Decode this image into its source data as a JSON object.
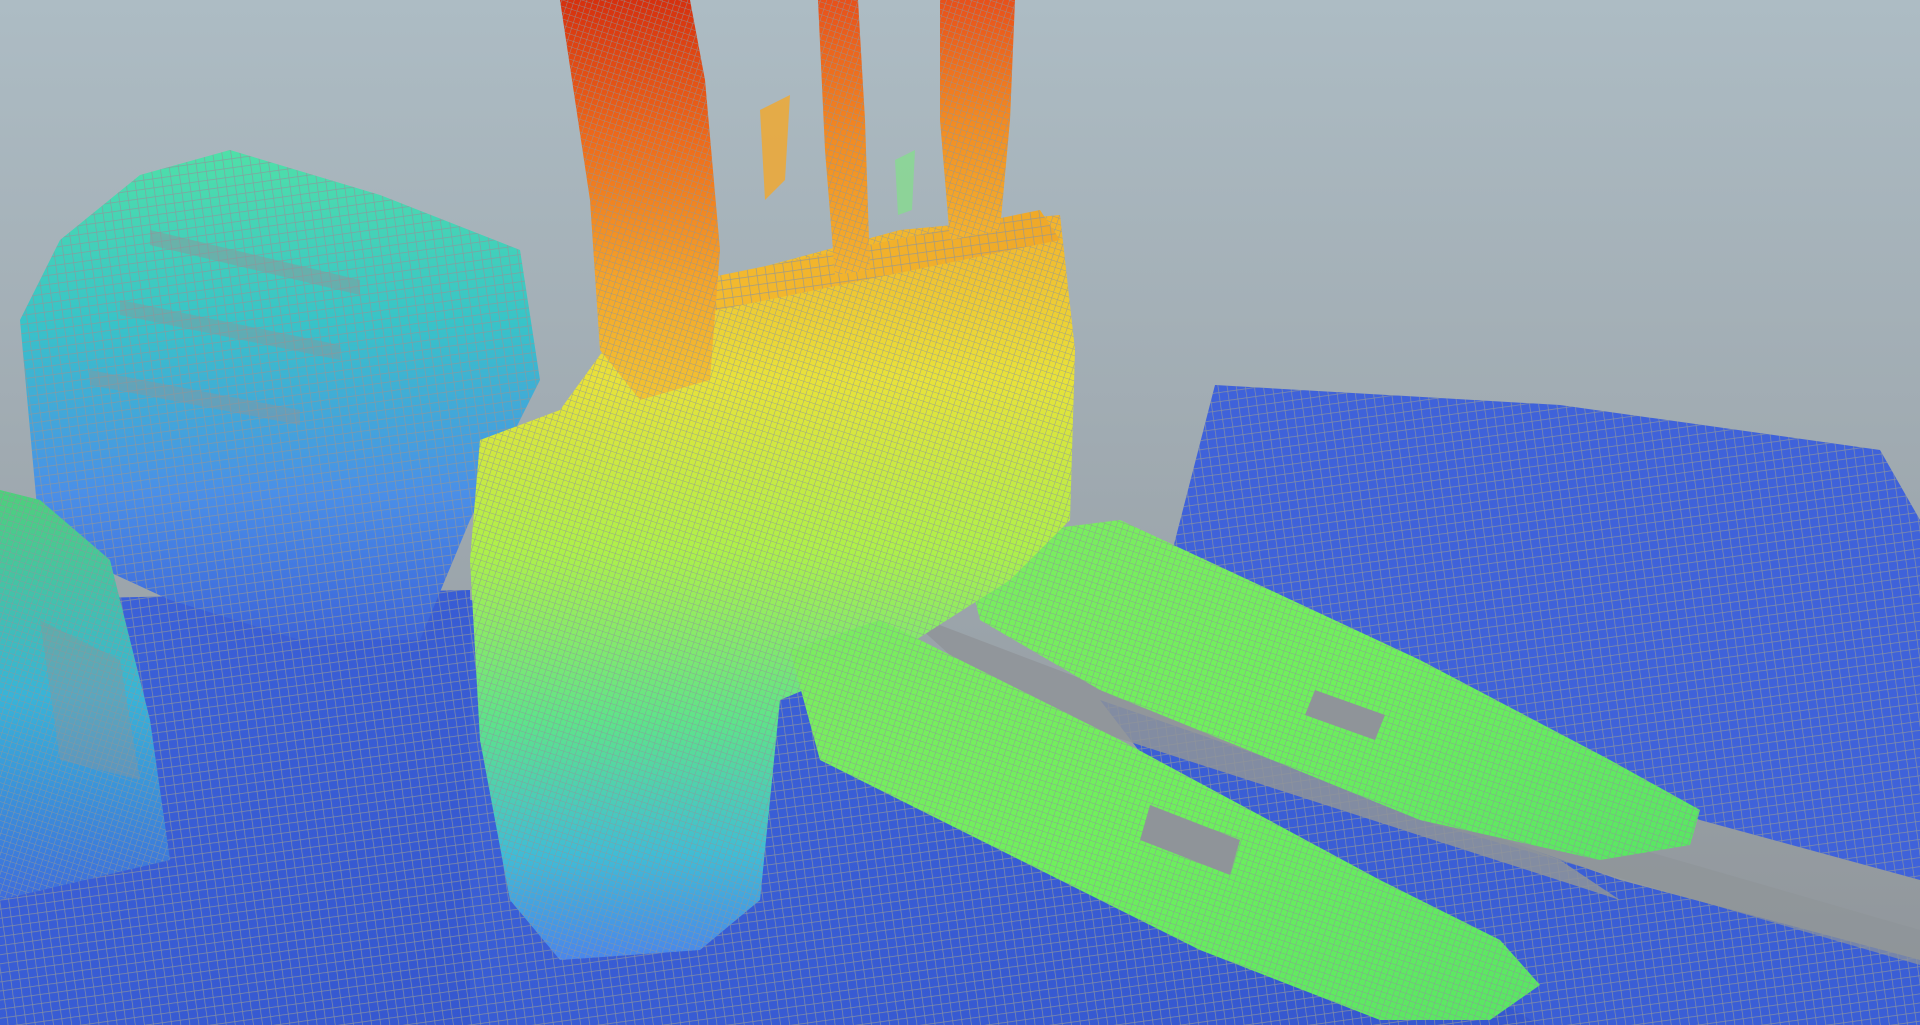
{
  "viewer": {
    "background_top": "#adbcc4",
    "background_bottom": "#8f9499",
    "mesh_line": "#8f969b"
  },
  "colormap": {
    "name": "jet-height",
    "stops": [
      "#3a5fd8",
      "#4f9ef0",
      "#38d0c0",
      "#7cf07a",
      "#c8ee3a",
      "#f6c232",
      "#f08a22",
      "#d8300e"
    ]
  },
  "scene_objects": [
    {
      "name": "floor-plane",
      "color_level": 0.02
    },
    {
      "name": "left-device",
      "color_level": 0.3
    },
    {
      "name": "left-edge-object",
      "color_level": 0.25
    },
    {
      "name": "right-slab",
      "color_level": 0.02
    },
    {
      "name": "gripper-body",
      "color_level": 0.55
    },
    {
      "name": "gripper-finger-front",
      "color_level": 0.45
    },
    {
      "name": "gripper-finger-back",
      "color_level": 0.45
    },
    {
      "name": "vertical-cables",
      "color_level": 0.9
    }
  ]
}
